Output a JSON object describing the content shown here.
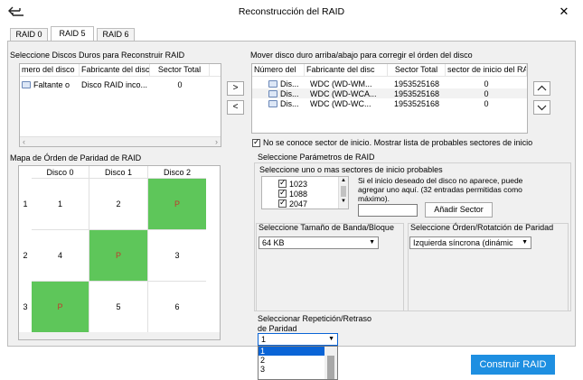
{
  "window": {
    "title": "Reconstrucción del RAID"
  },
  "tabs": [
    {
      "label": "RAID 0"
    },
    {
      "label": "RAID 5"
    },
    {
      "label": "RAID 6"
    }
  ],
  "select_disks": {
    "heading": "Seleccione Discos Duros para Reconstruir RAID",
    "columns": [
      "mero del disco",
      "Fabricante del disc",
      "Sector Total"
    ],
    "rows": [
      {
        "num": "Faltante o",
        "maker": "Disco RAID inco...",
        "sectors": "0"
      }
    ]
  },
  "move_disks": {
    "heading": "Mover disco duro arriba/abajo para corregir el órden del disco",
    "columns": [
      "Número del",
      "Fabricante del disc",
      "Sector Total",
      "sector de inicio del RA"
    ],
    "rows": [
      {
        "num": "Dis...",
        "maker": "WDC (WD-WM...",
        "sectors": "1953525168",
        "start": "0"
      },
      {
        "num": "Dis...",
        "maker": "WDC (WD-WCA...",
        "sectors": "1953525168",
        "start": "0"
      },
      {
        "num": "Dis...",
        "maker": "WDC (WD-WC...",
        "sectors": "1953525168",
        "start": "0"
      }
    ]
  },
  "buttons": {
    "add": ">",
    "remove": "<",
    "up": "^",
    "down": "v",
    "build": "Construir RAID",
    "add_sector": "Añadir Sector"
  },
  "parity_map": {
    "heading": "Mapa de Órden de Paridad de RAID",
    "columns": [
      "Disco 0",
      "Disco 1",
      "Disco 2"
    ],
    "rows": [
      {
        "n": "1",
        "cells": [
          "1",
          "2",
          "P"
        ]
      },
      {
        "n": "2",
        "cells": [
          "4",
          "P",
          "3"
        ]
      },
      {
        "n": "3",
        "cells": [
          "P",
          "5",
          "6"
        ]
      }
    ],
    "colors": {
      "parity_fill": "#5ec65a",
      "parity_text": "#c0392b"
    }
  },
  "unknown_start": {
    "label": "No se conoce sector de inicio. Mostrar lista de probables sectores de inicio",
    "checked": true
  },
  "params": {
    "heading": "Seleccione Parámetros de RAID",
    "start_sectors_label": "Seleccione uno o mas sectores de inicio probables",
    "sectors": [
      {
        "value": "1023",
        "checked": true
      },
      {
        "value": "1088",
        "checked": true
      },
      {
        "value": "2047",
        "checked": true
      }
    ],
    "hint": "Si el inicio deseado del disco no aparece, puede agregar uno aquí. (32 entradas permitidas como máximo).",
    "sector_input_value": "",
    "stripe_label": "Seleccione Tamaño de Banda/Bloque",
    "stripe_value": "64 KB",
    "rotation_label": "Seleccione Órden/Rotatción de Paridad",
    "rotation_value": "Izquierda síncrona (dinámic",
    "repeat_label_1": "Seleccionar Repetición/Retraso",
    "repeat_label_2": "de Paridad",
    "repeat_value": "1",
    "repeat_options": [
      "1",
      "2",
      "3"
    ]
  },
  "colors": {
    "accent": "#1e8fe1",
    "selection": "#0a64d6"
  }
}
